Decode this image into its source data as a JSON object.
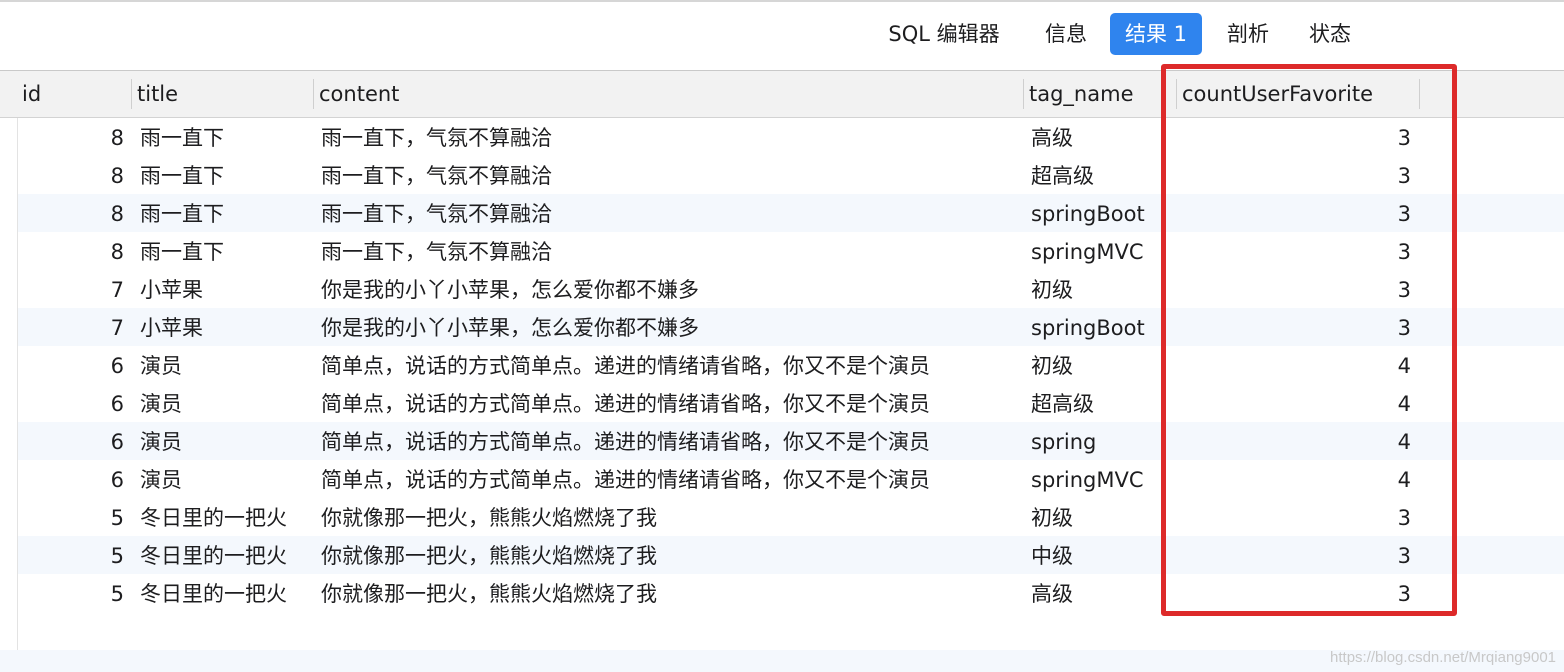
{
  "tabs": [
    {
      "label": "SQL 编辑器",
      "active": false
    },
    {
      "label": "信息",
      "active": false
    },
    {
      "label": "结果 1",
      "active": true
    },
    {
      "label": "剖析",
      "active": false
    },
    {
      "label": "状态",
      "active": false
    }
  ],
  "columns": [
    "id",
    "title",
    "content",
    "tag_name",
    "countUserFavorite"
  ],
  "rows": [
    {
      "id": "8",
      "title": "雨一直下",
      "content": "雨一直下，气氛不算融洽",
      "tag_name": "高级",
      "count": "3"
    },
    {
      "id": "8",
      "title": "雨一直下",
      "content": "雨一直下，气氛不算融洽",
      "tag_name": "超高级",
      "count": "3"
    },
    {
      "id": "8",
      "title": "雨一直下",
      "content": "雨一直下，气氛不算融洽",
      "tag_name": "springBoot",
      "count": "3"
    },
    {
      "id": "8",
      "title": "雨一直下",
      "content": "雨一直下，气氛不算融洽",
      "tag_name": "springMVC",
      "count": "3"
    },
    {
      "id": "7",
      "title": "小苹果",
      "content": "你是我的小丫小苹果，怎么爱你都不嫌多",
      "tag_name": "初级",
      "count": "3"
    },
    {
      "id": "7",
      "title": "小苹果",
      "content": "你是我的小丫小苹果，怎么爱你都不嫌多",
      "tag_name": "springBoot",
      "count": "3"
    },
    {
      "id": "6",
      "title": "演员",
      "content": "简单点，说话的方式简单点。递进的情绪请省略，你又不是个演员",
      "tag_name": "初级",
      "count": "4"
    },
    {
      "id": "6",
      "title": "演员",
      "content": "简单点，说话的方式简单点。递进的情绪请省略，你又不是个演员",
      "tag_name": "超高级",
      "count": "4"
    },
    {
      "id": "6",
      "title": "演员",
      "content": "简单点，说话的方式简单点。递进的情绪请省略，你又不是个演员",
      "tag_name": "spring",
      "count": "4"
    },
    {
      "id": "6",
      "title": "演员",
      "content": "简单点，说话的方式简单点。递进的情绪请省略，你又不是个演员",
      "tag_name": "springMVC",
      "count": "4"
    },
    {
      "id": "5",
      "title": "冬日里的一把火",
      "content": "你就像那一把火，熊熊火焰燃烧了我",
      "tag_name": "初级",
      "count": "3"
    },
    {
      "id": "5",
      "title": "冬日里的一把火",
      "content": "你就像那一把火，熊熊火焰燃烧了我",
      "tag_name": "中级",
      "count": "3"
    },
    {
      "id": "5",
      "title": "冬日里的一把火",
      "content": "你就像那一把火，熊熊火焰燃烧了我",
      "tag_name": "高级",
      "count": "3"
    }
  ],
  "watermark": "https://blog.csdn.net/Mrqiang9001",
  "colors": {
    "active_tab": "#2f84ee",
    "highlight": "#dd2a2a",
    "alt_row": "#f4f8fd"
  }
}
